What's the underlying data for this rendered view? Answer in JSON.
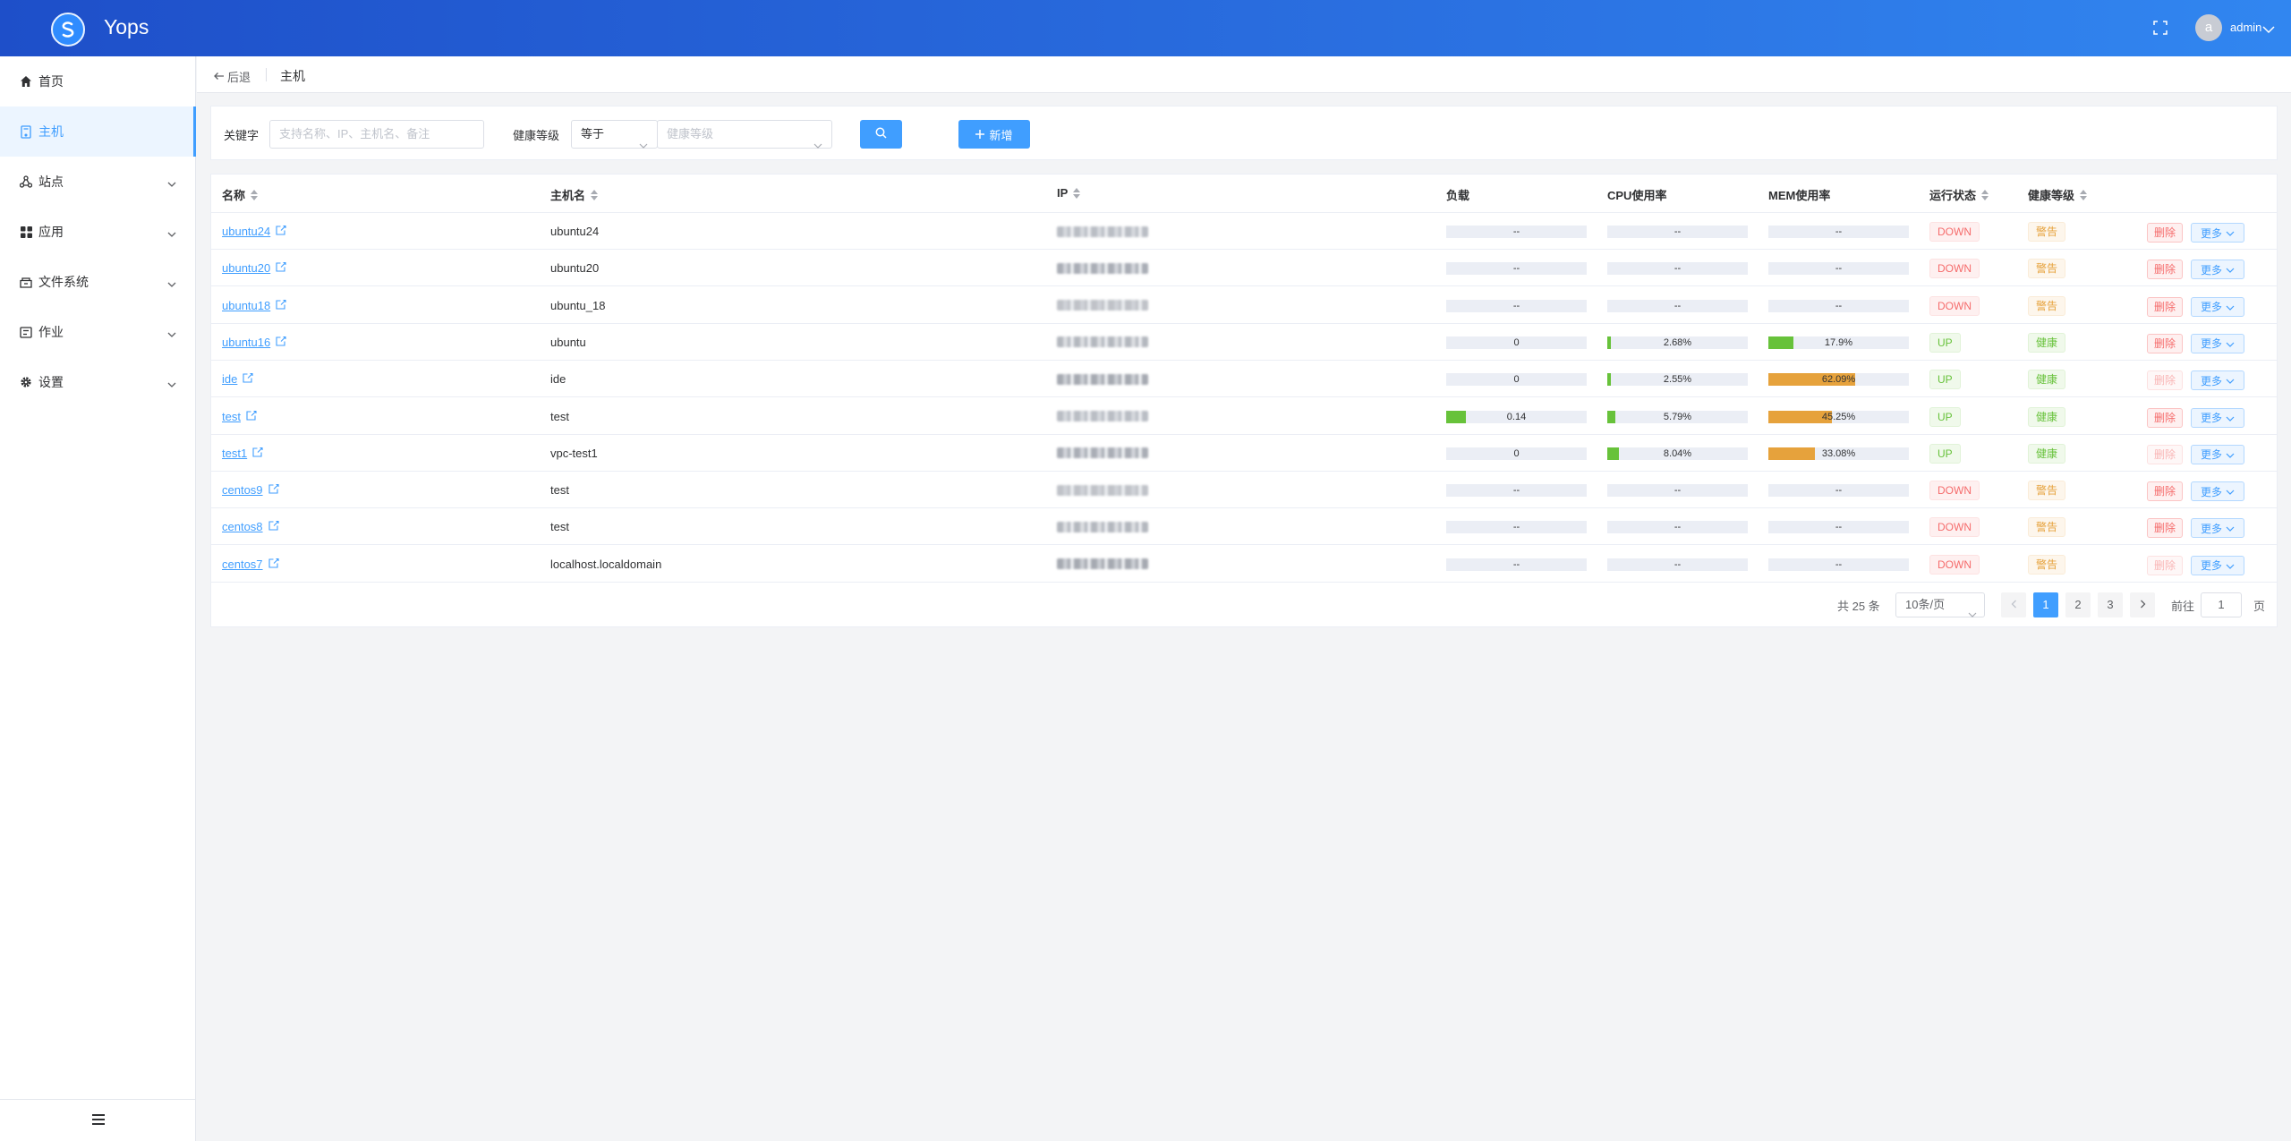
{
  "header": {
    "app_title": "Yops",
    "username": "admin",
    "avatar_letter": "a"
  },
  "sidebar": {
    "items": [
      {
        "label": "首页",
        "icon": "home-icon",
        "active": false,
        "expandable": false
      },
      {
        "label": "主机",
        "icon": "host-icon",
        "active": true,
        "expandable": false
      },
      {
        "label": "站点",
        "icon": "site-icon",
        "active": false,
        "expandable": true
      },
      {
        "label": "应用",
        "icon": "apps-icon",
        "active": false,
        "expandable": true
      },
      {
        "label": "文件系统",
        "icon": "filesystem-icon",
        "active": false,
        "expandable": true
      },
      {
        "label": "作业",
        "icon": "job-icon",
        "active": false,
        "expandable": true
      },
      {
        "label": "设置",
        "icon": "gear-icon",
        "active": false,
        "expandable": true
      }
    ]
  },
  "breadcrumb": {
    "back_label": "后退",
    "current": "主机"
  },
  "search": {
    "keyword_label": "关键字",
    "keyword_placeholder": "支持名称、IP、主机名、备注",
    "health_label": "健康等级",
    "operator_value": "等于",
    "health_placeholder": "健康等级",
    "add_label": "新增"
  },
  "table": {
    "columns": [
      "名称",
      "主机名",
      "IP",
      "负载",
      "CPU使用率",
      "MEM使用率",
      "运行状态",
      "健康等级"
    ],
    "rows": [
      {
        "name": "ubuntu24",
        "hostname": "ubuntu24",
        "load": "--",
        "load_pct": 0,
        "cpu": "--",
        "cpu_pct": 0,
        "mem": "--",
        "mem_pct": 0,
        "status": "DOWN",
        "health": "警告",
        "delete_label": "删除",
        "delete_disabled": false,
        "more_label": "更多"
      },
      {
        "name": "ubuntu20",
        "hostname": "ubuntu20",
        "load": "--",
        "load_pct": 0,
        "cpu": "--",
        "cpu_pct": 0,
        "mem": "--",
        "mem_pct": 0,
        "status": "DOWN",
        "health": "警告",
        "delete_label": "删除",
        "delete_disabled": false,
        "more_label": "更多"
      },
      {
        "name": "ubuntu18",
        "hostname": "ubuntu_18",
        "load": "--",
        "load_pct": 0,
        "cpu": "--",
        "cpu_pct": 0,
        "mem": "--",
        "mem_pct": 0,
        "status": "DOWN",
        "health": "警告",
        "delete_label": "删除",
        "delete_disabled": false,
        "more_label": "更多"
      },
      {
        "name": "ubuntu16",
        "hostname": "ubuntu",
        "load": "0",
        "load_pct": 0,
        "cpu": "2.68%",
        "cpu_pct": 2.68,
        "mem": "17.9%",
        "mem_pct": 17.9,
        "status": "UP",
        "health": "健康",
        "delete_label": "删除",
        "delete_disabled": false,
        "more_label": "更多"
      },
      {
        "name": "ide",
        "hostname": "ide",
        "load": "0",
        "load_pct": 0,
        "cpu": "2.55%",
        "cpu_pct": 2.55,
        "mem": "62.09%",
        "mem_pct": 62.09,
        "status": "UP",
        "health": "健康",
        "delete_label": "删除",
        "delete_disabled": true,
        "more_label": "更多"
      },
      {
        "name": "test",
        "hostname": "test",
        "load": "0.14",
        "load_pct": 14,
        "cpu": "5.79%",
        "cpu_pct": 5.79,
        "mem": "45.25%",
        "mem_pct": 45.25,
        "status": "UP",
        "health": "健康",
        "delete_label": "删除",
        "delete_disabled": false,
        "more_label": "更多"
      },
      {
        "name": "test1",
        "hostname": "vpc-test1",
        "load": "0",
        "load_pct": 0,
        "cpu": "8.04%",
        "cpu_pct": 8.04,
        "mem": "33.08%",
        "mem_pct": 33.08,
        "status": "UP",
        "health": "健康",
        "delete_label": "删除",
        "delete_disabled": true,
        "more_label": "更多"
      },
      {
        "name": "centos9",
        "hostname": "test",
        "load": "--",
        "load_pct": 0,
        "cpu": "--",
        "cpu_pct": 0,
        "mem": "--",
        "mem_pct": 0,
        "status": "DOWN",
        "health": "警告",
        "delete_label": "删除",
        "delete_disabled": false,
        "more_label": "更多"
      },
      {
        "name": "centos8",
        "hostname": "test",
        "load": "--",
        "load_pct": 0,
        "cpu": "--",
        "cpu_pct": 0,
        "mem": "--",
        "mem_pct": 0,
        "status": "DOWN",
        "health": "警告",
        "delete_label": "删除",
        "delete_disabled": false,
        "more_label": "更多"
      },
      {
        "name": "centos7",
        "hostname": "localhost.localdomain",
        "load": "--",
        "load_pct": 0,
        "cpu": "--",
        "cpu_pct": 0,
        "mem": "--",
        "mem_pct": 0,
        "status": "DOWN",
        "health": "警告",
        "delete_label": "删除",
        "delete_disabled": true,
        "more_label": "更多"
      }
    ]
  },
  "pagination": {
    "total_text": "共 25 条",
    "page_size": "10条/页",
    "pages": [
      "1",
      "2",
      "3"
    ],
    "current_page": "1",
    "goto_label": "前往",
    "goto_value": "1",
    "page_suffix": "页"
  },
  "colors": {
    "accent": "#409eff",
    "danger": "#f56c6c",
    "success": "#67c23a",
    "warning": "#e6a23c",
    "mem_bar": "#e6a23c",
    "cpu_bar": "#67c23a"
  }
}
